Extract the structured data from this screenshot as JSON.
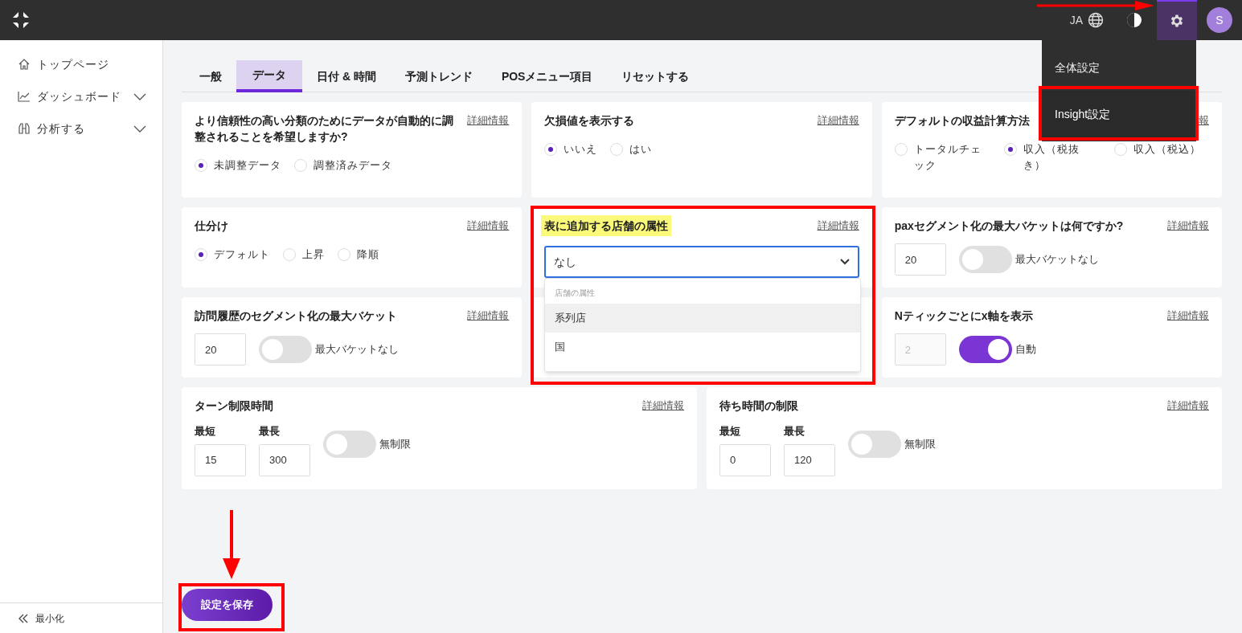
{
  "header": {
    "language": "JA",
    "avatar": "S"
  },
  "settings_menu": {
    "items": [
      {
        "label": "全体設定",
        "selected": false
      },
      {
        "label": "Insight設定",
        "selected": true
      }
    ]
  },
  "sidebar": {
    "items": [
      {
        "label": "トップページ",
        "expandable": false
      },
      {
        "label": "ダッシュボード",
        "expandable": true
      },
      {
        "label": "分析する",
        "expandable": true
      }
    ],
    "collapse_label": "最小化"
  },
  "tabs": [
    {
      "label": "一般",
      "selected": false
    },
    {
      "label": "データ",
      "selected": true
    },
    {
      "label": "日付 & 時間",
      "selected": false
    },
    {
      "label": "予測トレンド",
      "selected": false
    },
    {
      "label": "POSメニュー項目",
      "selected": false
    },
    {
      "label": "リセットする",
      "selected": false
    }
  ],
  "card_rows": [
    [
      {
        "kind": "radio",
        "title": "より信頼性の高い分類のためにデータが自動的に調整されることを希望しますか?",
        "link": "詳細情報",
        "options": [
          {
            "label": "未調整データ",
            "selected": true
          },
          {
            "label": "調整済みデータ",
            "selected": false
          }
        ]
      },
      {
        "kind": "radio",
        "title": "欠損値を表示する",
        "link": "詳細情報",
        "options": [
          {
            "label": "いいえ",
            "selected": true
          },
          {
            "label": "はい",
            "selected": false
          }
        ]
      },
      {
        "kind": "radio",
        "title": "デフォルトの収益計算方法",
        "link": "報",
        "options": [
          {
            "label": "トータルチェック",
            "selected": false
          },
          {
            "label": "収入（税抜き）",
            "selected": true
          },
          {
            "label": "収入（税込）",
            "selected": false
          }
        ]
      }
    ],
    [
      {
        "kind": "radio",
        "title": "仕分け",
        "link": "詳細情報",
        "options": [
          {
            "label": "デフォルト",
            "selected": true
          },
          {
            "label": "上昇",
            "selected": false
          },
          {
            "label": "降順",
            "selected": false
          }
        ]
      },
      {
        "kind": "select",
        "title": "表に追加する店舗の属性",
        "highlighted": true,
        "link": "詳細情報",
        "value": "なし",
        "open": true,
        "group_label": "店舗の属性",
        "options": [
          {
            "label": "系列店",
            "highlighted": true
          },
          {
            "label": "国",
            "highlighted": false
          }
        ]
      },
      {
        "kind": "number_toggle",
        "title": "paxセグメント化の最大バケットは何ですか?",
        "link": "詳細情報",
        "value": "20",
        "disabled": false,
        "on": false,
        "toggle_label": "最大バケットなし"
      }
    ],
    [
      {
        "kind": "number_toggle",
        "title": "訪問履歴のセグメント化の最大バケット",
        "link": "詳細情報",
        "value": "20",
        "disabled": false,
        "on": false,
        "toggle_label": "最大バケットなし"
      },
      {
        "kind": "number_toggle",
        "title": "Nティックごとにx軸を表示",
        "link": "詳細情報",
        "value": "2",
        "disabled": true,
        "on": true,
        "toggle_label": "自動"
      }
    ]
  ],
  "wide_cards": [
    {
      "kind": "min_max",
      "title": "ターン制限時間",
      "link": "詳細情報",
      "min_label": "最短",
      "max_label": "最長",
      "min": "15",
      "max": "300",
      "on": false,
      "toggle_label": "無制限"
    },
    {
      "kind": "min_max",
      "title": "待ち時間の制限",
      "link": "詳細情報",
      "min_label": "最短",
      "max_label": "最長",
      "min": "0",
      "max": "120",
      "on": false,
      "toggle_label": "無制限"
    }
  ],
  "save_button": "設定を保存"
}
